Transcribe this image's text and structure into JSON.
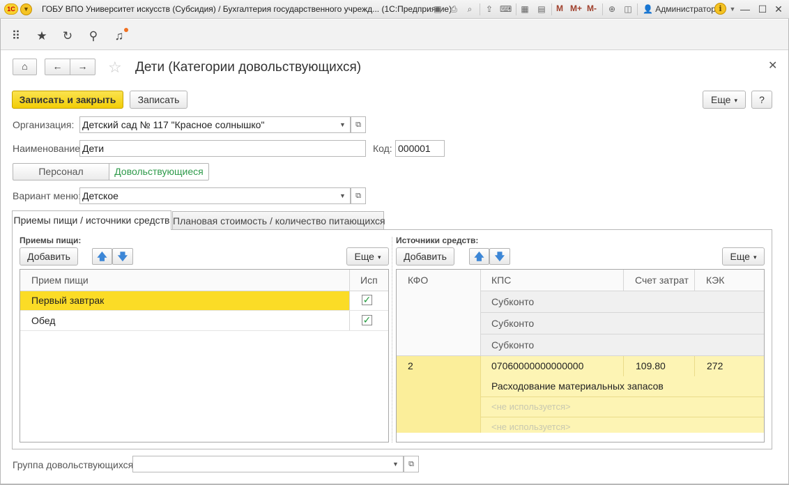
{
  "window": {
    "title": "ГОБУ ВПО Университет искусств (Субсидия) / Бухгалтерия государственного учрежд... (1С:Предприятие)",
    "logo": "1С",
    "user": "Администратор",
    "m_buttons": [
      "M",
      "M+",
      "M-"
    ]
  },
  "form": {
    "title": "Дети (Категории довольствующихся)",
    "save_close": "Записать и закрыть",
    "save": "Записать",
    "more": "Еще",
    "help": "?"
  },
  "fields": {
    "org_label": "Организация:",
    "org_value": "Детский сад № 117 \"Красное солнышко\"",
    "name_label": "Наименование:",
    "name_value": "Дети",
    "code_label": "Код:",
    "code_value": "000001",
    "menu_label": "Вариант меню:",
    "menu_value": "Детское",
    "group_label": "Группа довольствующихся:",
    "group_value": ""
  },
  "toggle": {
    "options": [
      "Персонал",
      "Довольствующиеся"
    ],
    "selected": "Довольствующиеся"
  },
  "tabs": [
    {
      "label": "Приемы пищи / источники средств",
      "active": true
    },
    {
      "label": "Плановая стоимость / количество питающихся",
      "active": false
    }
  ],
  "meals": {
    "title": "Приемы пищи:",
    "add": "Добавить",
    "more": "Еще",
    "columns": [
      "Прием пищи",
      "Исп"
    ],
    "rows": [
      {
        "name": "Первый завтрак",
        "used": true,
        "selected": true
      },
      {
        "name": "Обед",
        "used": true,
        "selected": false
      }
    ]
  },
  "sources": {
    "title": "Источники средств:",
    "add": "Добавить",
    "more": "Еще",
    "columns": [
      "КФО",
      "КПС",
      "Счет затрат",
      "КЭК"
    ],
    "subheaders": [
      "Субконто",
      "Субконто",
      "Субконто"
    ],
    "row": {
      "kfo": "2",
      "kps": "07060000000000000",
      "account": "109.80",
      "kek": "272",
      "sub1": "Расходование материальных запасов",
      "sub2": "<не используется>",
      "sub3": "<не используется>"
    }
  },
  "colors": {
    "primary_button": "#f2cd07",
    "selected_row": "#fbdc26",
    "table_row_highlight": "#fdf2a8",
    "toggle_selected_text": "#2e9a4a"
  }
}
